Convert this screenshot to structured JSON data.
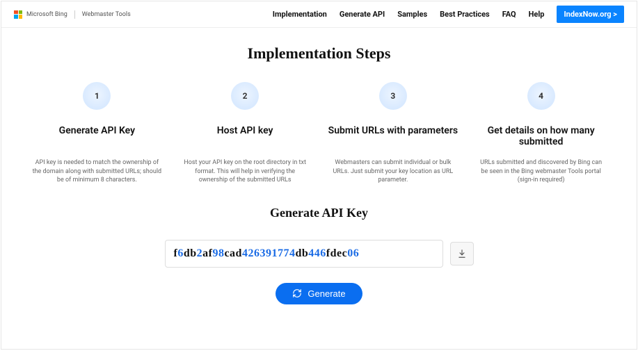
{
  "brand": {
    "name": "Microsoft Bing",
    "product": "Webmaster Tools"
  },
  "nav": {
    "items": [
      {
        "label": "Implementation"
      },
      {
        "label": "Generate API"
      },
      {
        "label": "Samples"
      },
      {
        "label": "Best Practices"
      },
      {
        "label": "FAQ"
      },
      {
        "label": "Help"
      }
    ],
    "cta": "IndexNow.org >"
  },
  "section_title": "Implementation Steps",
  "steps": [
    {
      "num": "1",
      "title": "Generate API Key",
      "desc": "API key is needed to match the ownership of the domain along with submitted URLs; should be of minimum 8 characters."
    },
    {
      "num": "2",
      "title": "Host API key",
      "desc": "Host your API key on the root directory in txt format. This will help in verifying the ownership of the submitted URLs"
    },
    {
      "num": "3",
      "title": "Submit URLs with parameters",
      "desc": "Webmasters can submit individual or bulk URLs. Just submit your key location as URL parameter."
    },
    {
      "num": "4",
      "title": "Get details on how many submitted",
      "desc": "URLs submitted and discovered by Bing can be seen in the Bing webmaster Tools portal (sign-in required)"
    }
  ],
  "generate": {
    "title": "Generate API Key",
    "key_segments": [
      {
        "t": "f",
        "hl": false
      },
      {
        "t": "6",
        "hl": true
      },
      {
        "t": "db",
        "hl": false
      },
      {
        "t": "2",
        "hl": true
      },
      {
        "t": "af",
        "hl": false
      },
      {
        "t": "98",
        "hl": true
      },
      {
        "t": "cad",
        "hl": false
      },
      {
        "t": "426391774",
        "hl": true
      },
      {
        "t": "db",
        "hl": false
      },
      {
        "t": "446",
        "hl": true
      },
      {
        "t": "fdec",
        "hl": false
      },
      {
        "t": "06",
        "hl": true
      }
    ],
    "key_plain": "f6db2af98cad426391774db446fdec06",
    "button": "Generate"
  }
}
